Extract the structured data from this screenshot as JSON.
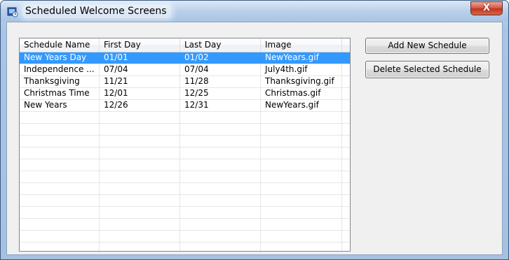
{
  "window": {
    "title": "Scheduled Welcome Screens",
    "close_label": "X",
    "app_icon": "schedule-app-icon",
    "close_icon": "close-icon"
  },
  "listview": {
    "columns": [
      "Schedule Name",
      "First Day",
      "Last Day",
      "Image"
    ],
    "rows": [
      [
        "New Years Day",
        "01/01",
        "01/02",
        "NewYears.gif"
      ],
      [
        "Independence ...",
        "07/04",
        "07/04",
        "July4th.gif"
      ],
      [
        "Thanksgiving",
        "11/21",
        "11/28",
        "Thanksgiving.gif"
      ],
      [
        "Christmas Time",
        "12/01",
        "12/25",
        "Christmas.gif"
      ],
      [
        "New Years",
        "12/26",
        "12/31",
        "NewYears.gif"
      ]
    ],
    "selected_row": 0
  },
  "buttons": {
    "add_label": "Add New Schedule",
    "delete_label": "Delete Selected Schedule"
  },
  "colors": {
    "selection": "#3399ff",
    "close_button": "#c7402a",
    "titlebar": "#b9d0ea"
  }
}
